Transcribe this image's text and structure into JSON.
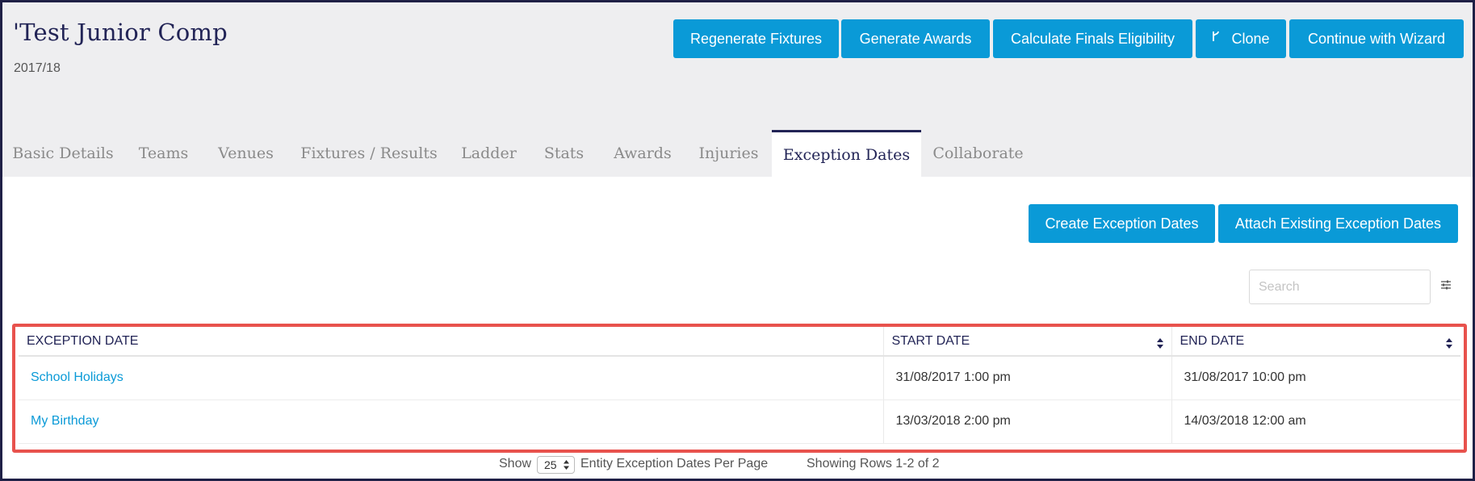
{
  "competition": {
    "title": "'Test Junior Comp",
    "season": "2017/18"
  },
  "actions": {
    "regenerate": "Regenerate Fixtures",
    "awards": "Generate Awards",
    "finals": "Calculate Finals Eligibility",
    "clone": "Clone",
    "wizard": "Continue with Wizard"
  },
  "tabs": [
    "Basic Details",
    "Teams",
    "Venues",
    "Fixtures / Results",
    "Ladder",
    "Stats",
    "Awards",
    "Injuries",
    "Exception Dates",
    "Collaborate"
  ],
  "active_tab": "Exception Dates",
  "page_actions": {
    "create": "Create Exception Dates",
    "attach": "Attach Existing Exception Dates"
  },
  "search": {
    "placeholder": "Search",
    "value": ""
  },
  "table": {
    "columns": [
      "EXCEPTION DATE",
      "START DATE",
      "END DATE"
    ],
    "rows": [
      {
        "name": "School Holidays",
        "start": "31/08/2017 1:00 pm",
        "end": "31/08/2017 10:00 pm"
      },
      {
        "name": "My Birthday",
        "start": "13/03/2018 2:00 pm",
        "end": "14/03/2018 12:00 am"
      }
    ]
  },
  "pagination": {
    "show_label": "Show",
    "per_page": "25",
    "per_page_label": "Entity Exception Dates Per Page",
    "rows_info": "Showing Rows 1-2 of 2"
  },
  "colors": {
    "accent": "#0a9ad7",
    "navy": "#222456",
    "highlight": "#e8524d",
    "header_bg": "#eeeef0"
  }
}
